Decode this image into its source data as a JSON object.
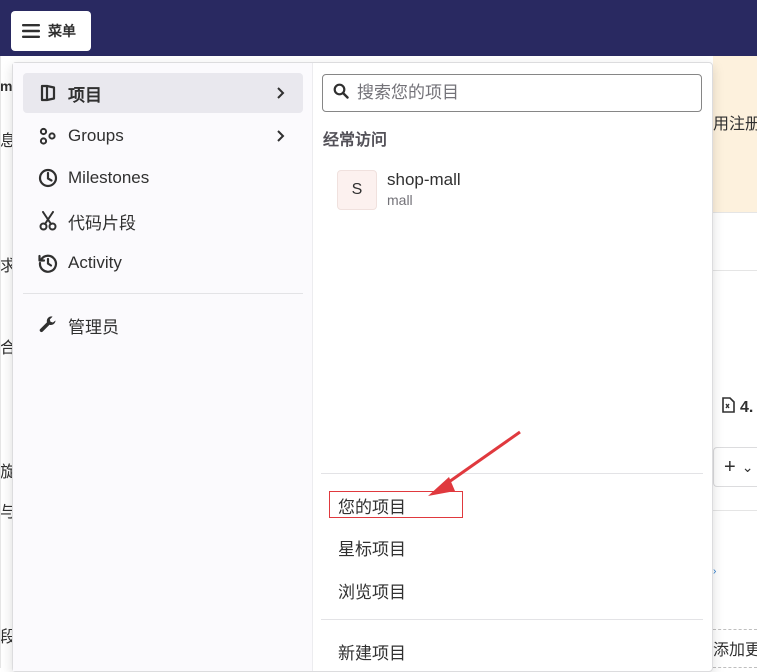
{
  "topbar": {
    "menu_label": "菜单",
    "bg_color": "#292961"
  },
  "background_page": {
    "frag_m": "m",
    "frag_xi": "息",
    "frag_qiu": "求",
    "frag_he": "合",
    "frag_xuan": "旋",
    "frag_yu": "与",
    "frag_duan": "段",
    "frag_zhuce": "用注册",
    "frag_count": "4.",
    "frag_add": "添加更",
    "plus": "+",
    "caret": "⌄"
  },
  "nav": {
    "items": [
      {
        "label": "项目",
        "icon": "project-icon",
        "has_chevron": true,
        "active": true
      },
      {
        "label": "Groups",
        "icon": "groups-icon",
        "has_chevron": true,
        "active": false
      },
      {
        "label": "Milestones",
        "icon": "clock-icon",
        "has_chevron": false,
        "active": false
      },
      {
        "label": "代码片段",
        "icon": "scissors-icon",
        "has_chevron": false,
        "active": false
      },
      {
        "label": "Activity",
        "icon": "history-icon",
        "has_chevron": false,
        "active": false
      },
      {
        "label": "管理员",
        "icon": "wrench-icon",
        "has_chevron": false,
        "active": false
      }
    ]
  },
  "panel": {
    "search_placeholder": "搜索您的项目",
    "frequent_title": "经常访问",
    "frequent_project": {
      "avatar_letter": "S",
      "name": "shop-mall",
      "namespace": "mall"
    },
    "links": [
      "您的项目",
      "星标项目",
      "浏览项目"
    ],
    "new_project": "新建项目"
  },
  "annotation": {
    "color": "#e0393e"
  }
}
